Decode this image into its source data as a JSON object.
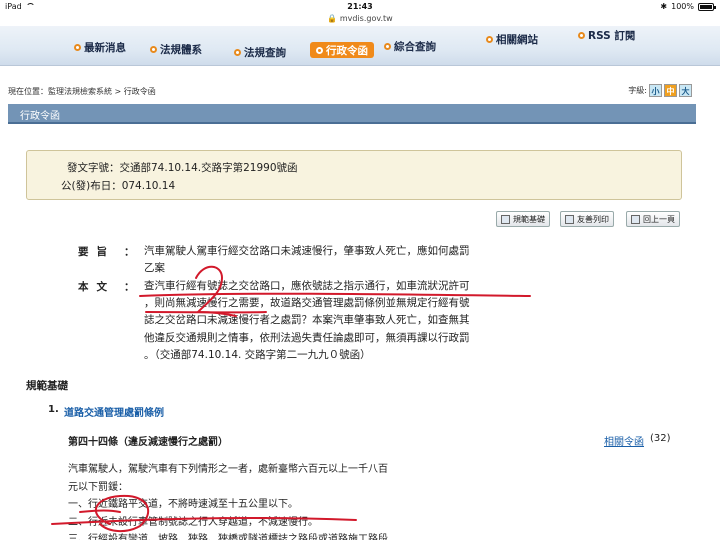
{
  "status_bar": {
    "device": "iPad",
    "time": "21:43",
    "battery": "100%"
  },
  "browser": {
    "url": "mvdis.gov.tw"
  },
  "nav": {
    "items": [
      {
        "label": "最新消息"
      },
      {
        "label": "法規體系"
      },
      {
        "label": "法規查詢"
      },
      {
        "label": "行政令函",
        "active": true
      },
      {
        "label": "綜合查詢"
      },
      {
        "label": "相關網站"
      },
      {
        "label": "RSS 訂閱"
      }
    ],
    "accent": "#f08a1a"
  },
  "breadcrumb": "現在位置：監理法規檢索系統 > 行政令函",
  "font_size": {
    "label": "字級:",
    "options": [
      "小",
      "中",
      "大"
    ],
    "selected": "中"
  },
  "section_tab": "行政令函",
  "doc_info": {
    "number": "發文字號：交通部74.10.14.交路字第21990號函",
    "date": "公(發)布日：074.10.14"
  },
  "actions": [
    {
      "label": "規範基礎",
      "icon": "document-icon"
    },
    {
      "label": "友善列印",
      "icon": "printer-icon"
    },
    {
      "label": "回上一頁",
      "icon": "back-arrow-icon"
    }
  ],
  "content": {
    "summary_label": "要旨",
    "summary_lines": [
      "汽車駕駛人駕車行經交岔路口未減速慢行，肇事致人死亡，應如何處罰",
      "乙案"
    ],
    "body_label": "本文",
    "body_lines": [
      "查汽車行經有號誌之交岔路口，應依號誌之指示通行，如車流狀況許可",
      "，則尚無減速慢行之需要，故道路交通管理處罰條例並無規定行經有號",
      "誌之交岔路口未減速慢行者之處罰？本案汽車肇事致人死亡，如查無其",
      "他違反交通規則之情事，依刑法過失責任論處即可，無須再課以行政罰",
      "。（交通部74.10.14. 交路字第二一九九０號函）"
    ]
  },
  "basis": {
    "heading": "規範基礎",
    "law_number": "1.",
    "law_title": "道路交通管理處罰條例",
    "article_title": "第四十四條（違反減速慢行之處罰）",
    "related_link": "相關令函",
    "related_count": "(32)",
    "article_lines": [
      "汽車駕駛人，駕駛汽車有下列情形之一者，處新臺幣六百元以上一千八百",
      "元以下罰鍰：",
      "一、行近鐵路平交道，不將時速減至十五公里以下。",
      "二、行近未設行車管制號誌之行人穿越道，不減速慢行。",
      "三、行經設有彎道、坡路、狹路、狹橋或隧道標誌之路段或道路施工路段"
    ]
  },
  "annotation_color": "#d2192b"
}
